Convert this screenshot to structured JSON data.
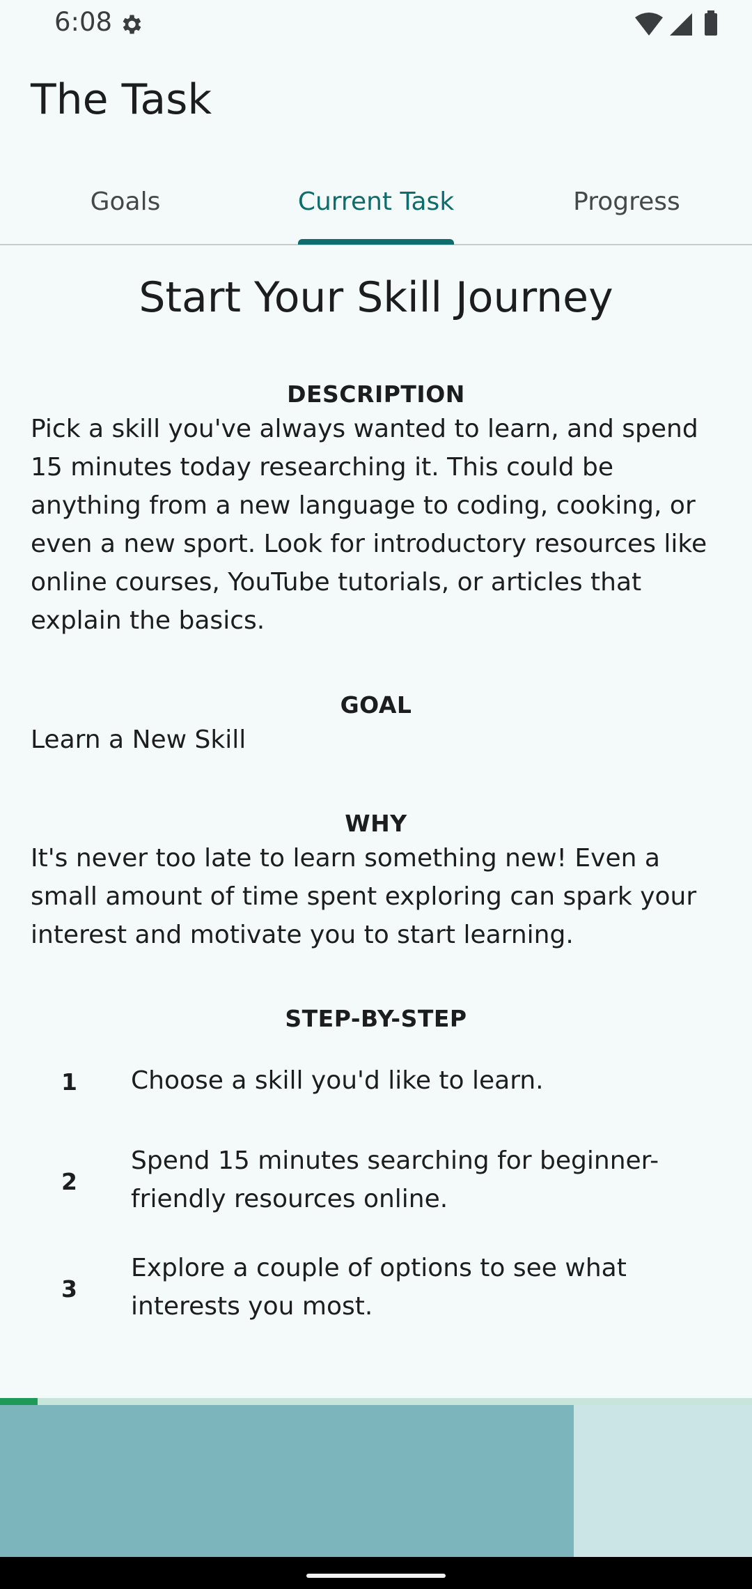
{
  "status_bar": {
    "time": "6:08",
    "icons": [
      "gear-icon",
      "wifi-icon",
      "signal-icon",
      "battery-icon"
    ]
  },
  "app": {
    "title": "The Task"
  },
  "tabs": [
    {
      "label": "Goals",
      "selected": false
    },
    {
      "label": "Current Task",
      "selected": true
    },
    {
      "label": "Progress",
      "selected": false
    }
  ],
  "task": {
    "heading": "Start Your Skill Journey",
    "description_label": "DESCRIPTION",
    "description": "Pick a skill you've always wanted to learn, and spend 15 minutes today researching it. This could be anything from a new language to coding, cooking, or even a new sport.  Look for introductory resources like online courses, YouTube tutorials, or articles that explain the basics.",
    "goal_label": "GOAL",
    "goal": "Learn a New Skill",
    "why_label": "WHY",
    "why": "It's never too late to learn something new!  Even a small amount of time spent exploring can spark your interest and motivate you to start learning.",
    "steps_label": "STEP-BY-STEP",
    "steps": [
      {
        "num": "1",
        "text": "Choose a skill you'd like to learn."
      },
      {
        "num": "2",
        "text": "Spend 15 minutes searching for beginner-friendly resources online."
      },
      {
        "num": "3",
        "text": "Explore a couple of options to see what interests you most."
      }
    ]
  },
  "timer_progress": 0.05,
  "colors": {
    "accent": "#0e6c6c",
    "progress": "#1e9a58"
  }
}
